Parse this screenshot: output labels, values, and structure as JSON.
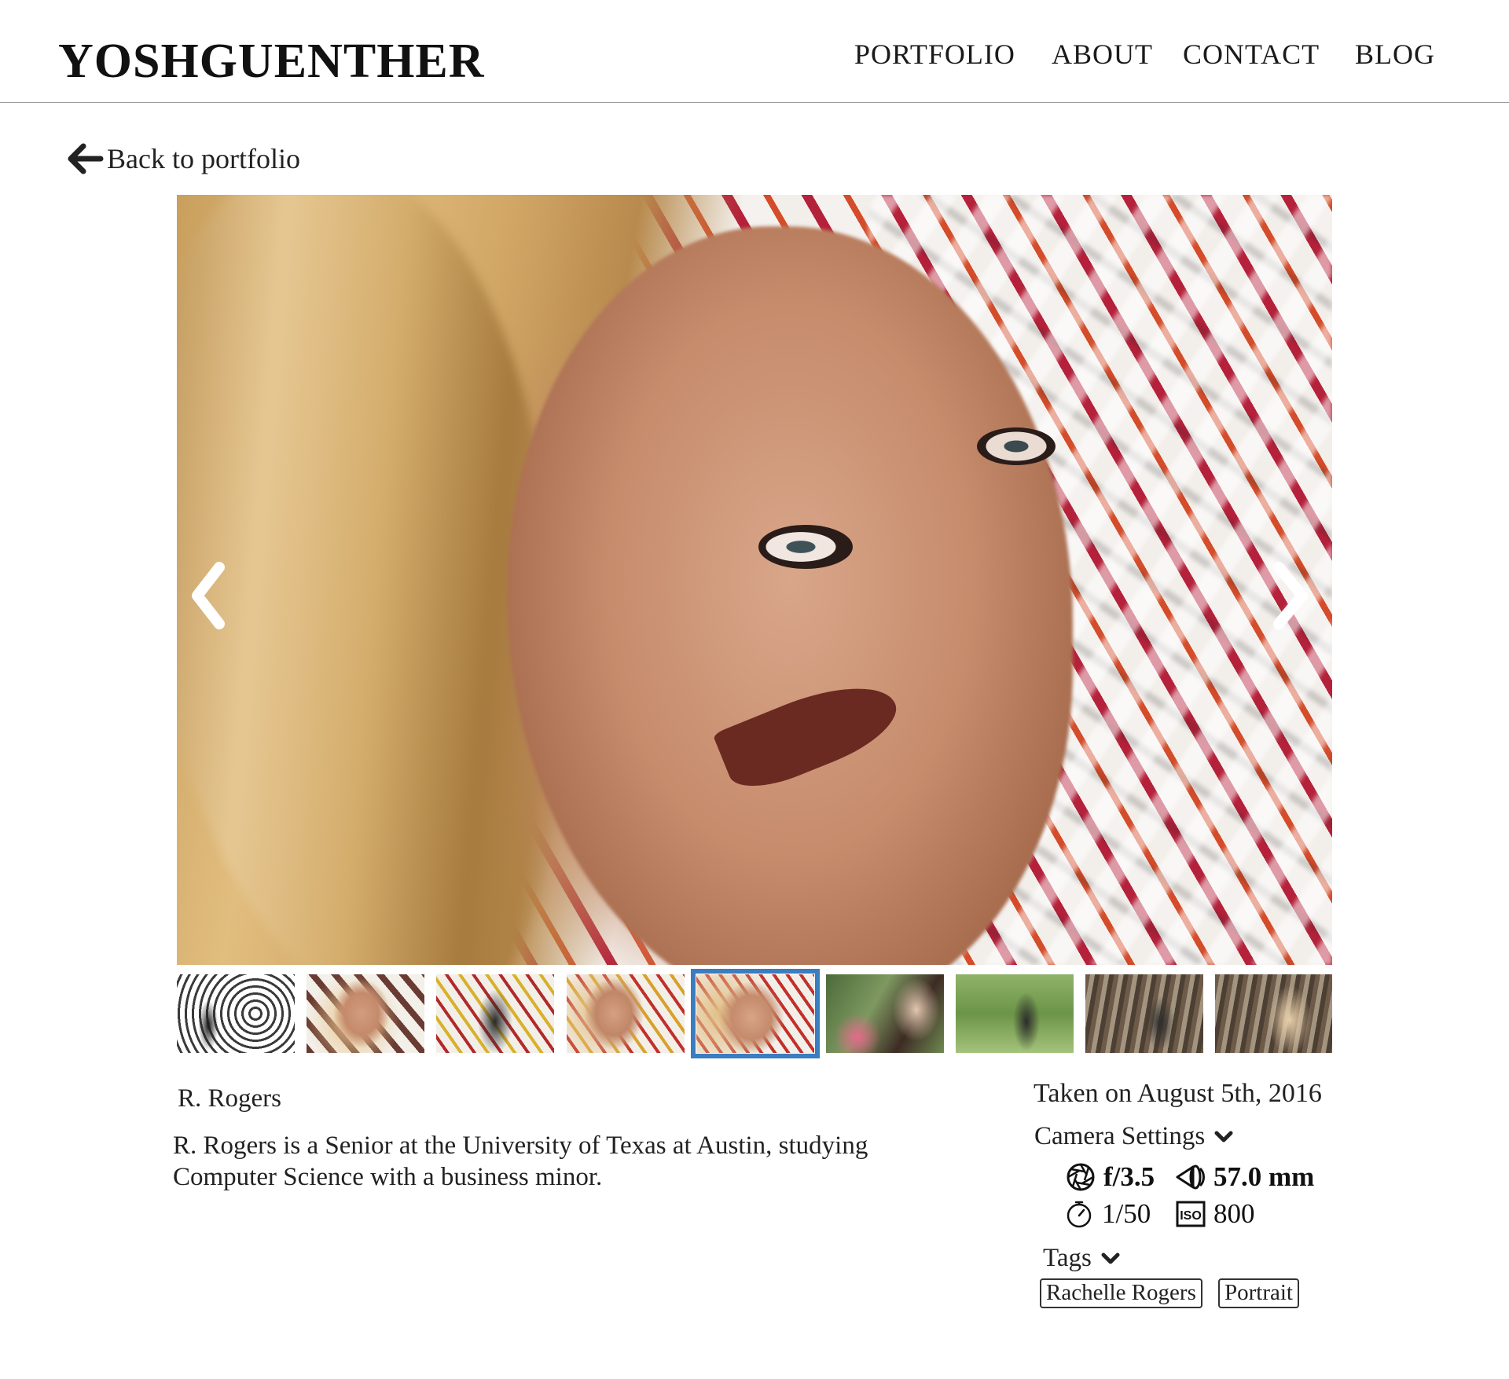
{
  "site": {
    "logo": "YOSHGUENTHER"
  },
  "nav": [
    "PORTFOLIO",
    "ABOUT",
    "CONTACT",
    "BLOG"
  ],
  "back_link": {
    "label": "Back to portfolio",
    "icon": "arrow-left-icon"
  },
  "photo": {
    "alt": "Portrait of R. Rogers",
    "prev_icon": "chevron-left-icon",
    "next_icon": "chevron-right-icon"
  },
  "thumbnails": {
    "count": 9,
    "active_index": 4,
    "active_color": "#3a7dc0"
  },
  "caption": {
    "title": "R. Rogers",
    "description": "R. Rogers is a Senior at the University of Texas at Austin, studying Computer Science with a business minor."
  },
  "meta": {
    "taken": "Taken on August 5th, 2016",
    "camera_settings_label": "Camera Settings",
    "aperture": "f/3.5",
    "focal_length": "57.0 mm",
    "shutter": "1/50",
    "iso": "800",
    "tags_label": "Tags",
    "tags": [
      "Rachelle Rogers",
      "Portrait"
    ]
  }
}
